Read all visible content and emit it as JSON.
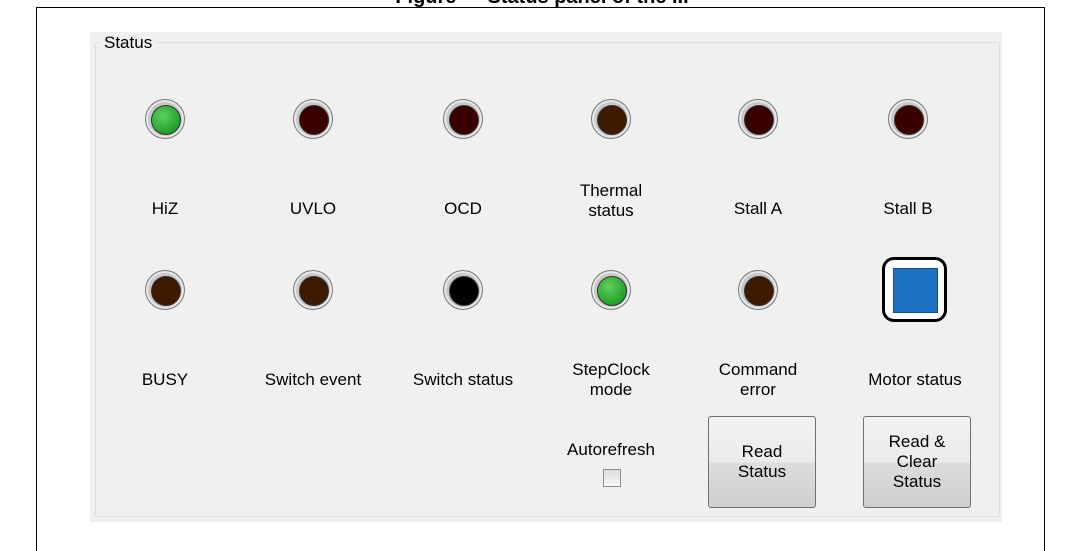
{
  "caption": "Figure — Status panel of the ...",
  "group_title": "Status",
  "row1": [
    {
      "label": "HiZ",
      "state": "on",
      "color": "#22a02a"
    },
    {
      "label": "UVLO",
      "state": "off",
      "color": "#3a0000"
    },
    {
      "label": "OCD",
      "state": "off",
      "color": "#3a0000"
    },
    {
      "label": "Thermal\nstatus",
      "state": "off",
      "color": "#3d1a00"
    },
    {
      "label": "Stall A",
      "state": "off",
      "color": "#3a0000"
    },
    {
      "label": "Stall B",
      "state": "off",
      "color": "#3a0000"
    }
  ],
  "row2": [
    {
      "label": "BUSY",
      "state": "off",
      "color": "#3d1a00"
    },
    {
      "label": "Switch event",
      "state": "off",
      "color": "#3d1a00"
    },
    {
      "label": "Switch status",
      "state": "off",
      "color": "#000000"
    },
    {
      "label": "StepClock\nmode",
      "state": "on",
      "color": "#22a02a"
    },
    {
      "label": "Command\nerror",
      "state": "off",
      "color": "#3d1a00"
    }
  ],
  "motor_status": {
    "label": "Motor status",
    "color": "#1e72c2"
  },
  "autorefresh": {
    "label": "Autorefresh",
    "checked": false
  },
  "buttons": {
    "read_status": "Read\nStatus",
    "read_clear_status": "Read &\nClear\nStatus"
  }
}
